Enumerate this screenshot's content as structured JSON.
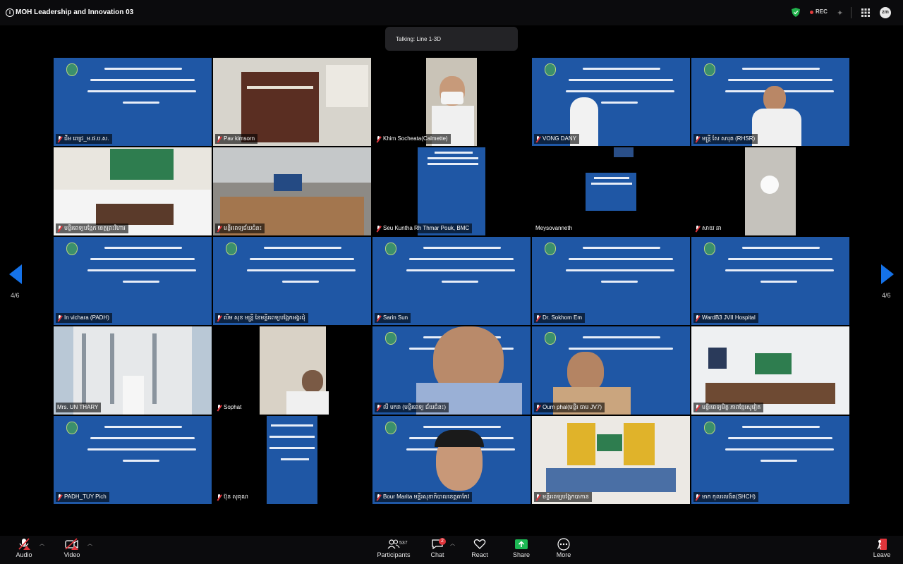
{
  "window": {
    "title": "MOH Leadership and Innovation 03",
    "rec_label": "REC",
    "avatar_text": "zm"
  },
  "talking": {
    "label": "Talking: Line 1-3D"
  },
  "pager": {
    "left": "4/6",
    "right": "4/6"
  },
  "tiles": [
    {
      "name": "ជីម ពេជ្រ_ម.ផ.ប.ស.",
      "kind": "slide"
    },
    {
      "name": "Pav kimsorn",
      "kind": "photo"
    },
    {
      "name": "Khim Socheata(Calmette)",
      "kind": "video"
    },
    {
      "name": "VONG DANY",
      "kind": "slide"
    },
    {
      "name": "មន្ត្រី សែ សារុត (RHSR)",
      "kind": "slide"
    },
    {
      "name": "មន្ទីរពេទ្យបង្អែក ខេត្តព្រះវិហារ",
      "kind": "photo"
    },
    {
      "name": "មន្ទីរពេទ្យជ័យជំនះ",
      "kind": "photo"
    },
    {
      "name": "Seu Kuntha Rh Thmar Pouk, BMC",
      "kind": "slide-small"
    },
    {
      "name": "Meysovanneth",
      "kind": "slide-small"
    },
    {
      "name": "សាយ ឆា",
      "kind": "video"
    },
    {
      "name": "In vichara (PADH)",
      "kind": "slide"
    },
    {
      "name": "លីម សុខ មន្ត្រី នៃមន្ទីរពេទ្យបង្អែកអង្គរជុំ",
      "kind": "slide"
    },
    {
      "name": "Sarin Sun",
      "kind": "slide"
    },
    {
      "name": "Dr. Sokhom Em",
      "kind": "slide"
    },
    {
      "name": "WardB3 JVII Hospital",
      "kind": "slide"
    },
    {
      "name": "Mrs. UN THARY",
      "kind": "photo"
    },
    {
      "name": "Sophat",
      "kind": "video"
    },
    {
      "name": "លី មករា (មន្ទីរពេទ្យ ជ័យជំនះ)",
      "kind": "video"
    },
    {
      "name": "Ourn phal(មន្ទីរ ចាម JV7)",
      "kind": "video"
    },
    {
      "name": "មន្ទីរពេទ្យមិត្ត ភាពខ្មែរសូវៀត",
      "kind": "photo"
    },
    {
      "name": "PADH_TUY Pich",
      "kind": "slide"
    },
    {
      "name": "ប៊ុន សុគុណ",
      "kind": "slide"
    },
    {
      "name": "Bour Marita មន្ទីរសុខាភិបាលខេត្តតាកែវ",
      "kind": "video"
    },
    {
      "name": "មន្ទីរពេទ្យបង្អែកបាកាន",
      "kind": "photo"
    },
    {
      "name": "មាក កុលលេងិត(SHCH)",
      "kind": "slide"
    }
  ],
  "toolbar": {
    "audio": "Audio",
    "video": "Video",
    "participants": "Participants",
    "participants_count": "537",
    "chat": "Chat",
    "chat_badge": "2",
    "react": "React",
    "share": "Share",
    "more": "More",
    "leave": "Leave"
  },
  "colors": {
    "slide_blue": "#1f57a5",
    "accent_blue": "#1572e8",
    "share_green": "#1db954",
    "danger_red": "#e0353b"
  }
}
